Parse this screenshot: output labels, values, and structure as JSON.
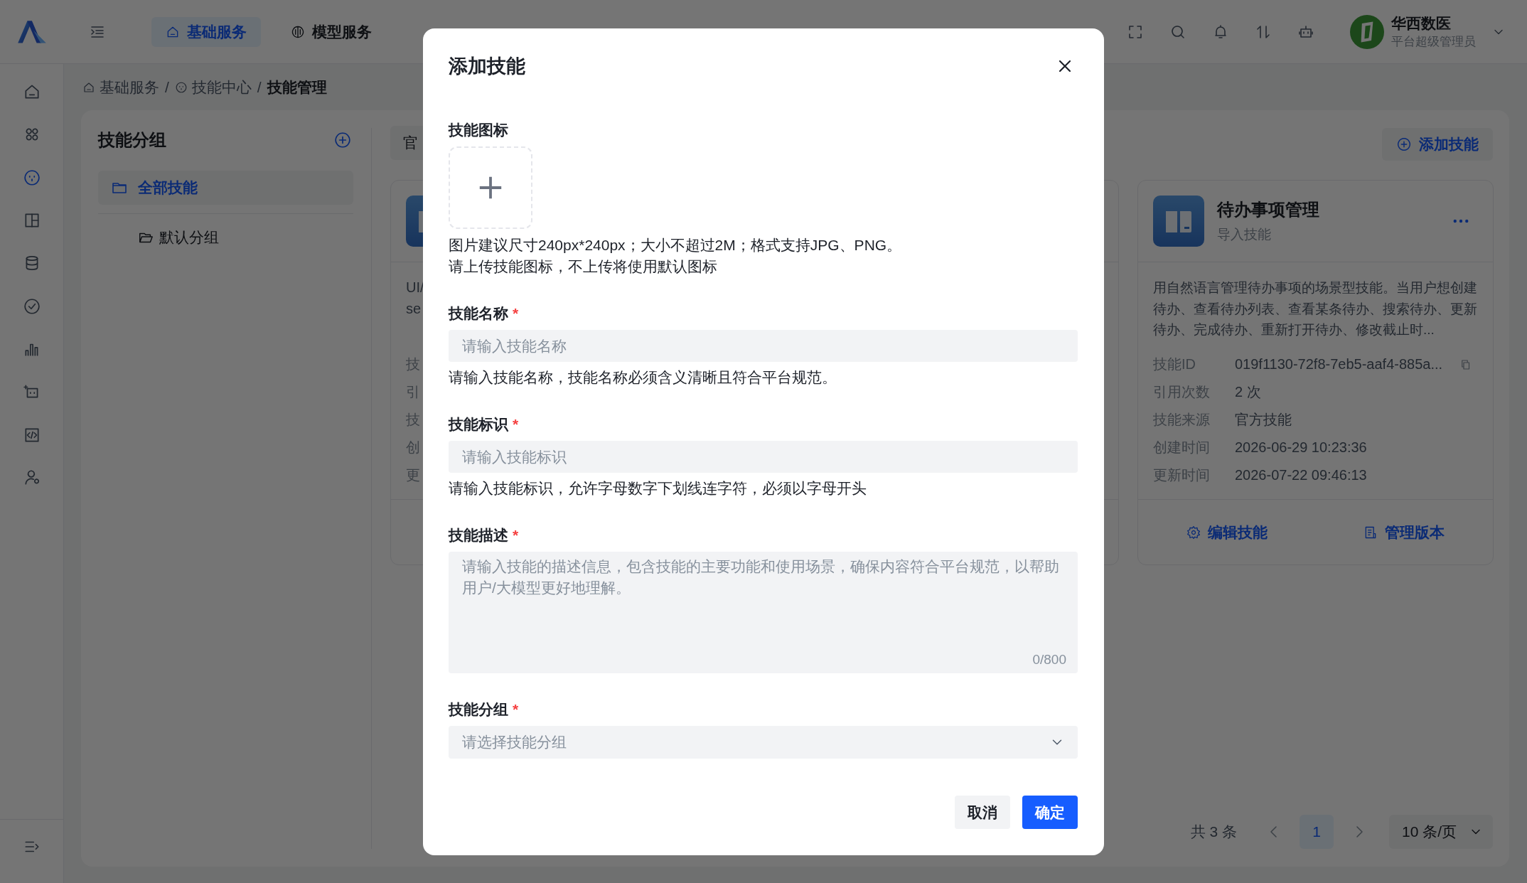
{
  "top_nav": {
    "tabs": [
      {
        "label": "基础服务",
        "selected": true
      },
      {
        "label": "模型服务",
        "selected": false
      }
    ]
  },
  "user": {
    "name": "华西数医",
    "role": "平台超级管理员"
  },
  "side_nav": {
    "items": [
      {
        "selected": false
      },
      {
        "selected": false
      },
      {
        "selected": true
      },
      {
        "selected": false
      },
      {
        "selected": false
      },
      {
        "selected": false
      },
      {
        "selected": false
      },
      {
        "selected": false
      },
      {
        "selected": false
      },
      {
        "selected": false
      }
    ]
  },
  "breadcrumb": [
    {
      "kind": "link",
      "label": "基础服务"
    },
    {
      "kind": "separator",
      "label": "/"
    },
    {
      "kind": "link",
      "label": "技能中心"
    },
    {
      "kind": "separator",
      "label": "/"
    },
    {
      "kind": "current",
      "label": "技能管理"
    }
  ],
  "groups_panel": {
    "title": "技能分组",
    "groups": [
      {
        "label": "全部技能",
        "selected": true,
        "children": [
          {
            "label": "默认分组",
            "selected": false
          }
        ]
      }
    ]
  },
  "filter_tab": {
    "label": "官"
  },
  "add_skill_button": {
    "label": "添加技能"
  },
  "cards": [
    {
      "kind": "partial",
      "description_lines": [
        "UI/",
        "se"
      ],
      "fields": [
        {
          "label": "技"
        },
        {
          "label": "引"
        },
        {
          "label": "技"
        },
        {
          "label": "创"
        },
        {
          "label": "更"
        }
      ]
    },
    {
      "kind": "full",
      "title": "待办事项管理",
      "subtitle": "导入技能",
      "description": "用自然语言管理待办事项的场景型技能。当用户想创建待办、查看待办列表、查看某条待办、搜索待办、更新待办、完成待办、重新打开待办、修改截止时...",
      "fields": [
        {
          "label": "技能ID",
          "value": "019f1130-72f8-7eb5-aaf4-885a...",
          "copyable": true
        },
        {
          "label": "引用次数",
          "value": "2 次",
          "copyable": false
        },
        {
          "label": "技能来源",
          "value": "官方技能",
          "copyable": false
        },
        {
          "label": "创建时间",
          "value": "2026-06-29 10:23:36",
          "copyable": false
        },
        {
          "label": "更新时间",
          "value": "2026-07-22 09:46:13",
          "copyable": false
        }
      ],
      "actions": [
        {
          "label": "编辑技能"
        },
        {
          "label": "管理版本"
        }
      ]
    }
  ],
  "pagination": {
    "total": "共 3 条",
    "pages": [
      {
        "label": "1",
        "selected": true
      }
    ],
    "page_size": "10 条/页"
  },
  "dialog": {
    "title": "添加技能",
    "fields": [
      {
        "kind": "upload",
        "label": "技能图标",
        "hints": [
          "图片建议尺寸240px*240px；大小不超过2M；格式支持JPG、PNG。",
          "请上传技能图标，不上传将使用默认图标"
        ]
      },
      {
        "kind": "input",
        "label": "技能名称",
        "required_mark": "*",
        "placeholder": "请输入技能名称",
        "help": "请输入技能名称，技能名称必须含义清晰且符合平台规范。"
      },
      {
        "kind": "input",
        "label": "技能标识",
        "required_mark": "*",
        "placeholder": "请输入技能标识",
        "help": "请输入技能标识，允许字母数字下划线连字符，必须以字母开头"
      },
      {
        "kind": "textarea",
        "label": "技能描述",
        "required_mark": "*",
        "placeholder": "请输入技能的描述信息，包含技能的主要功能和使用场景，确保内容符合平台规范，以帮助用户/大模型更好地理解。",
        "counter": "0/800"
      },
      {
        "kind": "select",
        "label": "技能分组",
        "required_mark": "*",
        "placeholder": "请选择技能分组"
      }
    ],
    "buttons": [
      {
        "kind": "secondary",
        "label": "取消"
      },
      {
        "kind": "primary",
        "label": "确定"
      }
    ]
  }
}
